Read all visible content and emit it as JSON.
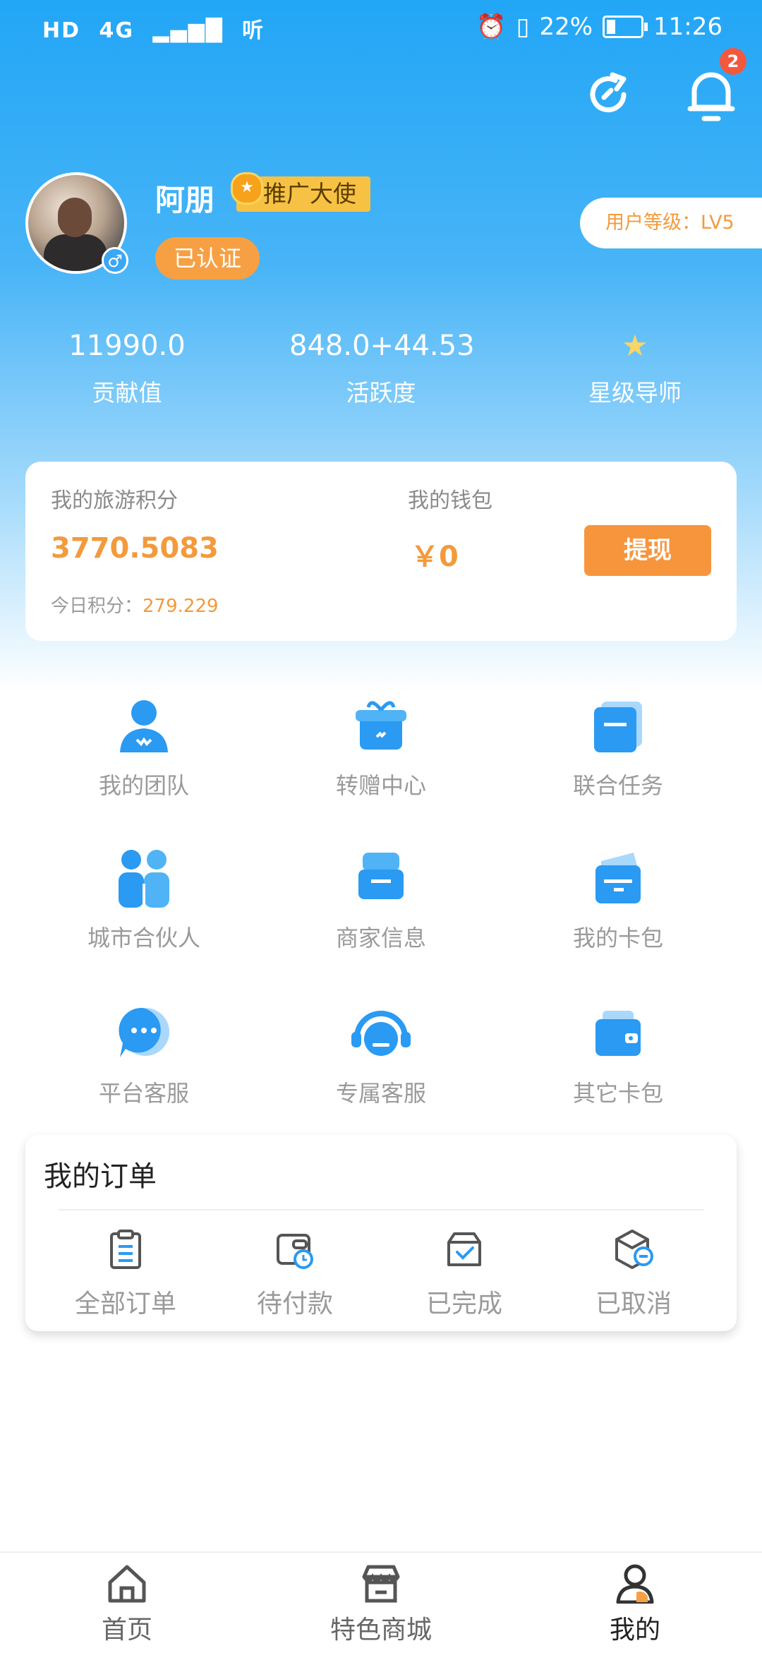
{
  "status_bar": {
    "left_items": [
      "HD",
      "4G",
      "听"
    ],
    "battery_percent": "22%",
    "time": "11:26"
  },
  "header": {
    "notification_count": "2"
  },
  "profile": {
    "username": "阿朋",
    "badge": "推广大使",
    "verified": "已认证",
    "gender_symbol": "♂",
    "level": "用户等级：LV5"
  },
  "stats": [
    {
      "value": "11990.0",
      "label": "贡献值"
    },
    {
      "value": "848.0+44.53",
      "label": "活跃度"
    },
    {
      "value": "★",
      "label": "星级导师"
    }
  ],
  "wallet_card": {
    "points_label": "我的旅游积分",
    "points_value": "3770.5083",
    "today_label": "今日积分：",
    "today_value": "279.229",
    "wallet_label": "我的钱包",
    "wallet_value": "￥0",
    "withdraw_button": "提现"
  },
  "menu": [
    {
      "label": "我的团队",
      "icon": "team-icon"
    },
    {
      "label": "转赠中心",
      "icon": "gift-icon"
    },
    {
      "label": "联合任务",
      "icon": "folder-icon"
    },
    {
      "label": "城市合伙人",
      "icon": "partners-icon"
    },
    {
      "label": "商家信息",
      "icon": "store-icon"
    },
    {
      "label": "我的卡包",
      "icon": "card-wallet-icon"
    },
    {
      "label": "平台客服",
      "icon": "chat-icon"
    },
    {
      "label": "专属客服",
      "icon": "headset-icon"
    },
    {
      "label": "其它卡包",
      "icon": "wallet-icon"
    }
  ],
  "orders": {
    "title": "我的订单",
    "items": [
      {
        "label": "全部订单",
        "icon": "clipboard-icon"
      },
      {
        "label": "待付款",
        "icon": "pending-payment-icon"
      },
      {
        "label": "已完成",
        "icon": "completed-box-icon"
      },
      {
        "label": "已取消",
        "icon": "cancelled-box-icon"
      }
    ]
  },
  "tabbar": [
    {
      "label": "首页",
      "icon": "home-icon"
    },
    {
      "label": "特色商城",
      "icon": "shop-icon"
    },
    {
      "label": "我的",
      "icon": "user-icon",
      "active": true
    }
  ],
  "colors": {
    "primary_blue": "#22a6f6",
    "accent_orange": "#f39a3c",
    "badge_red": "#f2583e"
  }
}
